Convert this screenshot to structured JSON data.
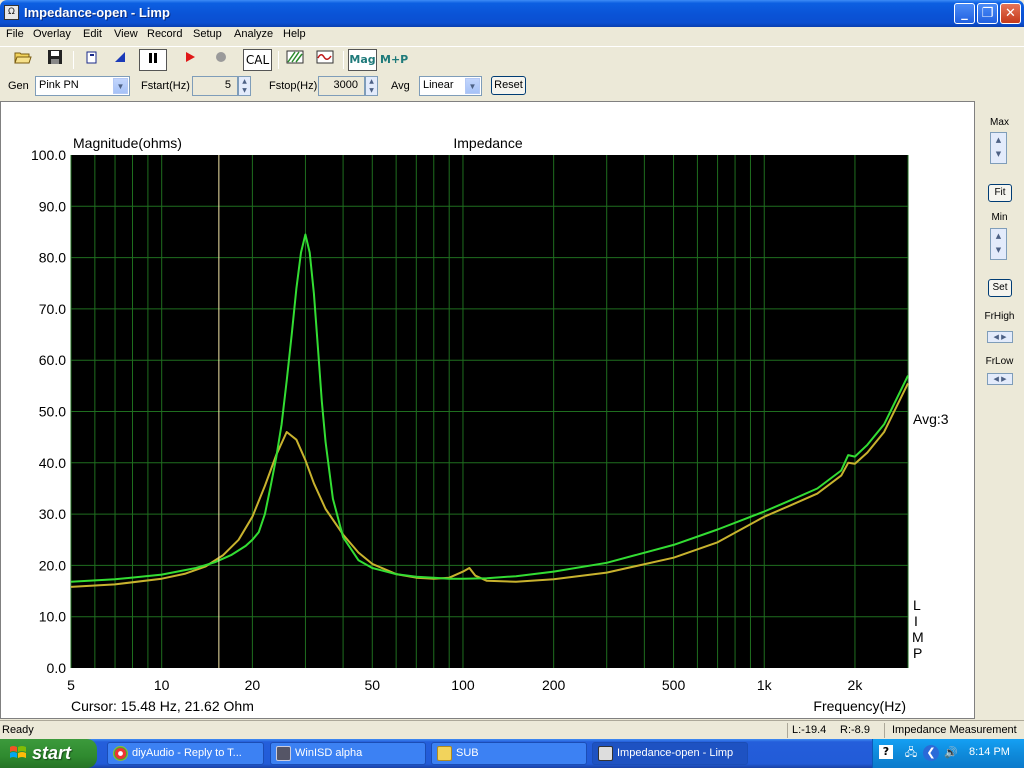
{
  "window": {
    "title": "Impedance-open - Limp",
    "app_icon_text": "Ω",
    "min_glyph": "_",
    "max_glyph": "❐",
    "close_glyph": "✕"
  },
  "menu": [
    "File",
    "Overlay",
    "Edit",
    "View",
    "Record",
    "Setup",
    "Analyze",
    "Help"
  ],
  "toolbar": {
    "cal_label": "CAL",
    "mag_label": "Mag",
    "mp_label": "M+P"
  },
  "controls": {
    "gen_label": "Gen",
    "gen_value": "Pink PN",
    "fstart_label": "Fstart(Hz)",
    "fstart_value": "5",
    "fstop_label": "Fstop(Hz)",
    "fstop_value": "3000",
    "avg_label": "Avg",
    "avg_value": "Linear",
    "reset_label": "Reset"
  },
  "right_panel": {
    "max_label": "Max",
    "fit_label": "Fit",
    "min_label": "Min",
    "set_label": "Set",
    "frhigh_label": "FrHigh",
    "frlow_label": "FrLow"
  },
  "plot": {
    "avg_text": "Avg:3",
    "cursor_text": "Cursor: 15.48 Hz, 21.62 Ohm",
    "limp_letters": [
      "L",
      "I",
      "M",
      "P"
    ]
  },
  "chart_data": {
    "type": "line",
    "title": "Impedance",
    "ylabel": "Magnitude(ohms)",
    "xlabel": "Frequency(Hz)",
    "x_scale": "log",
    "xlim": [
      5,
      3000
    ],
    "ylim": [
      0,
      100
    ],
    "y_ticks": [
      "0.0",
      "10.0",
      "20.0",
      "30.0",
      "40.0",
      "50.0",
      "60.0",
      "70.0",
      "80.0",
      "90.0",
      "100.0"
    ],
    "x_ticks": [
      {
        "value": 5,
        "label": "5"
      },
      {
        "value": 10,
        "label": "10"
      },
      {
        "value": 20,
        "label": "20"
      },
      {
        "value": 50,
        "label": "50"
      },
      {
        "value": 100,
        "label": "100"
      },
      {
        "value": 200,
        "label": "200"
      },
      {
        "value": 500,
        "label": "500"
      },
      {
        "value": 1000,
        "label": "1k"
      },
      {
        "value": 2000,
        "label": "2k"
      }
    ],
    "grid": true,
    "background": "#000000",
    "grid_color": "#1f6e1f",
    "cursor_x": 15.48,
    "series": [
      {
        "color": "#33dd33",
        "x": [
          5,
          7,
          10,
          13,
          15,
          17,
          19,
          20,
          21,
          22,
          23,
          24,
          25,
          26,
          27,
          28,
          29,
          30,
          31,
          32,
          33,
          34,
          35,
          37,
          40,
          45,
          50,
          60,
          70,
          80,
          90,
          100,
          120,
          150,
          200,
          300,
          500,
          700,
          1000,
          1200,
          1500,
          1800,
          1900,
          2000,
          2200,
          2500,
          3000
        ],
        "y": [
          16.8,
          17.3,
          18.2,
          19.5,
          20.6,
          22.0,
          23.8,
          25.0,
          26.5,
          30.0,
          35.5,
          41.0,
          47.5,
          56.0,
          65.0,
          74.0,
          81.0,
          84.5,
          81.0,
          73.0,
          62.5,
          52.0,
          44.0,
          33.0,
          25.5,
          21.0,
          19.5,
          18.3,
          17.8,
          17.6,
          17.4,
          17.4,
          17.5,
          17.9,
          18.8,
          20.5,
          24.0,
          27.0,
          30.5,
          32.5,
          35.0,
          38.5,
          41.5,
          41.2,
          43.5,
          47.5,
          57.0
        ]
      },
      {
        "color": "#c8b22e",
        "x": [
          5,
          7,
          10,
          12,
          14,
          16,
          18,
          20,
          22,
          24,
          26,
          28,
          30,
          32,
          35,
          40,
          45,
          50,
          60,
          70,
          80,
          90,
          95,
          100,
          105,
          110,
          120,
          150,
          200,
          300,
          500,
          700,
          1000,
          1200,
          1500,
          1800,
          1900,
          2000,
          2200,
          2500,
          3000
        ],
        "y": [
          15.8,
          16.3,
          17.4,
          18.4,
          19.8,
          22.0,
          25.0,
          29.5,
          35.5,
          41.5,
          46.0,
          44.5,
          40.5,
          36.0,
          31.0,
          26.0,
          22.5,
          20.3,
          18.3,
          17.6,
          17.4,
          17.6,
          18.2,
          18.8,
          19.5,
          18.0,
          17.0,
          16.8,
          17.3,
          18.6,
          21.5,
          24.5,
          29.5,
          31.5,
          34.0,
          37.5,
          40.0,
          39.8,
          42.0,
          46.0,
          55.5
        ]
      }
    ]
  },
  "status": {
    "ready": "Ready",
    "left": "L:-19.4",
    "right": "R:-8.9",
    "mode": "Impedance Measurement"
  },
  "taskbar": {
    "start_label": "start",
    "tasks": [
      "diyAudio - Reply to T...",
      "WinISD alpha",
      "SUB",
      "Impedance-open - Limp"
    ],
    "clock": "8:14 PM"
  }
}
